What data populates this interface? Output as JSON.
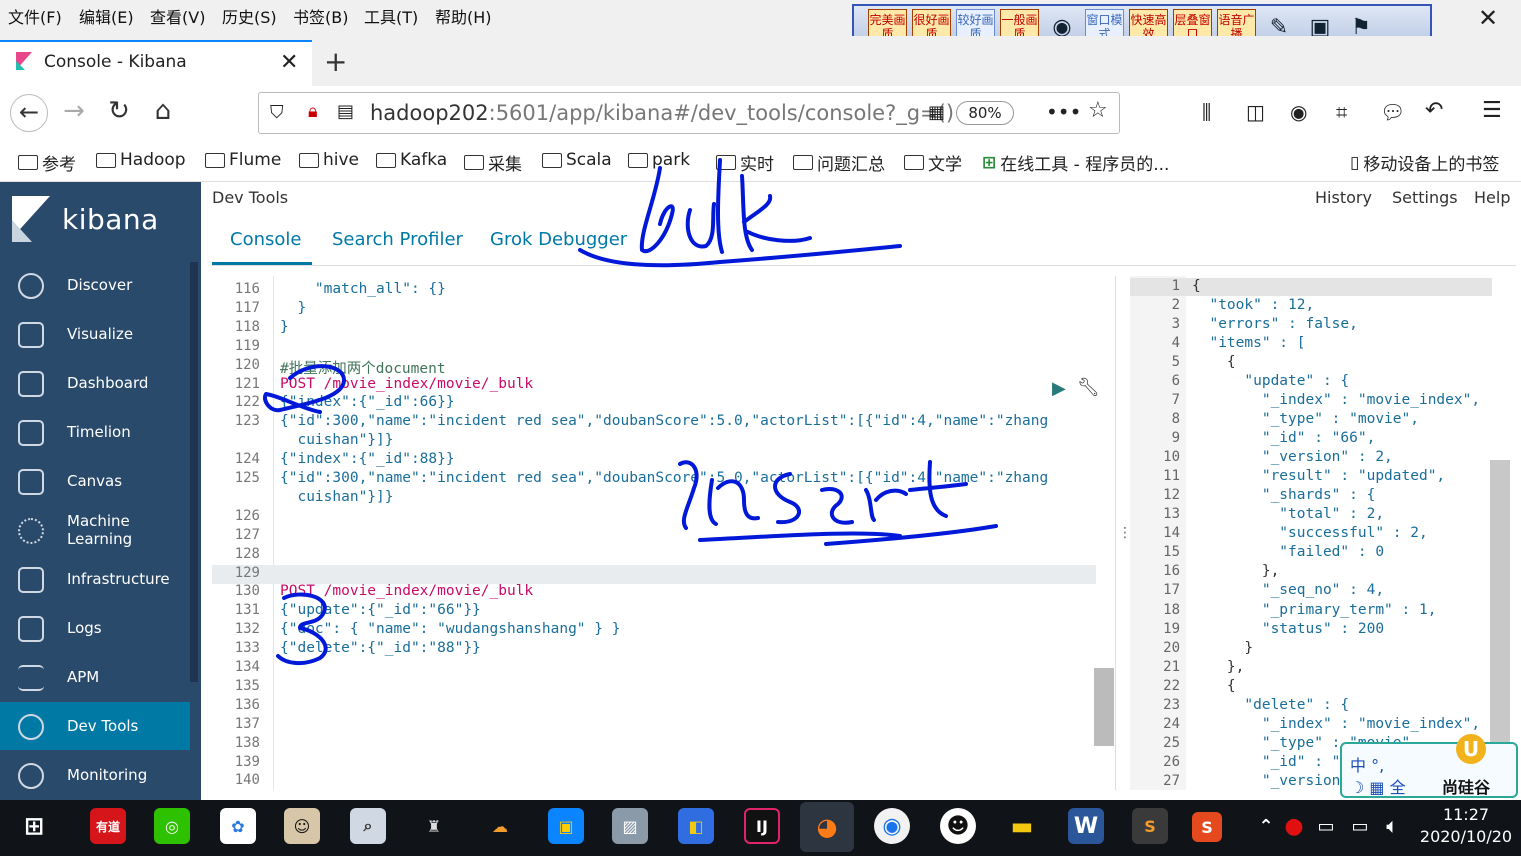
{
  "menubar": {
    "items": [
      "文件(F)",
      "编辑(E)",
      "查看(V)",
      "历史(S)",
      "书签(B)",
      "工具(T)",
      "帮助(H)"
    ]
  },
  "ext_toolbar": {
    "buttons": [
      "完美画质",
      "很好画质",
      "较好画质",
      "一般画质",
      "窗口模式",
      "快速高效",
      "层叠窗口",
      "语音广播"
    ]
  },
  "tab": {
    "title": "Console - Kibana"
  },
  "url": {
    "host": "hadoop202",
    "rest": ":5601/app/kibana#/dev_tools/console?_g=()",
    "zoom": "80%"
  },
  "bookmarks": [
    "参考",
    "Hadoop",
    "Flume",
    "hive",
    "Kafka",
    "采集",
    "Scala",
    "park",
    "实时",
    "问题汇总",
    "文学",
    "在线工具 - 程序员的...",
    "移动设备上的书签"
  ],
  "kibana": {
    "brand": "kibana",
    "nav": [
      "Discover",
      "Visualize",
      "Dashboard",
      "Timelion",
      "Canvas",
      "Machine Learning",
      "Infrastructure",
      "Logs",
      "APM",
      "Dev Tools",
      "Monitoring"
    ],
    "active": "Dev Tools"
  },
  "devtools": {
    "title": "Dev Tools",
    "links": [
      "History",
      "Settings",
      "Help"
    ],
    "tabs": [
      "Console",
      "Search Profiler",
      "Grok Debugger"
    ]
  },
  "editor": {
    "lines": [
      {
        "n": "116",
        "t": "    \"match_all\": {}"
      },
      {
        "n": "117",
        "t": "  }"
      },
      {
        "n": "118",
        "t": "}"
      },
      {
        "n": "119",
        "t": ""
      },
      {
        "n": "120",
        "t": "#批量添加两个document"
      },
      {
        "n": "121",
        "t": "POST /movie_index/movie/_bulk"
      },
      {
        "n": "122",
        "t": "{\"index\":{\"_id\":66}}"
      },
      {
        "n": "123",
        "t": "{\"id\":300,\"name\":\"incident red sea\",\"doubanScore\":5.0,\"actorList\":[{\"id\":4,\"name\":\"zhang"
      },
      {
        "n": "",
        "t": "  cuishan\"}]}"
      },
      {
        "n": "124",
        "t": "{\"index\":{\"_id\":88}}"
      },
      {
        "n": "125",
        "t": "{\"id\":300,\"name\":\"incident red sea\",\"doubanScore\":5.0,\"actorList\":[{\"id\":4,\"name\":\"zhang"
      },
      {
        "n": "",
        "t": "  cuishan\"}]}"
      },
      {
        "n": "126",
        "t": ""
      },
      {
        "n": "127",
        "t": ""
      },
      {
        "n": "128",
        "t": ""
      },
      {
        "n": "129",
        "t": ""
      },
      {
        "n": "130",
        "t": "POST /movie_index/movie/_bulk"
      },
      {
        "n": "131",
        "t": "{\"update\":{\"_id\":\"66\"}}"
      },
      {
        "n": "132",
        "t": "{\"doc\": { \"name\": \"wudangshanshang\" } }"
      },
      {
        "n": "133",
        "t": "{\"delete\":{\"_id\":\"88\"}}"
      },
      {
        "n": "134",
        "t": ""
      },
      {
        "n": "135",
        "t": ""
      },
      {
        "n": "136",
        "t": ""
      },
      {
        "n": "137",
        "t": ""
      },
      {
        "n": "138",
        "t": ""
      },
      {
        "n": "139",
        "t": ""
      },
      {
        "n": "140",
        "t": ""
      }
    ]
  },
  "output": {
    "lines": [
      {
        "n": "1",
        "t": "{"
      },
      {
        "n": "2",
        "t": "  \"took\" : 12,"
      },
      {
        "n": "3",
        "t": "  \"errors\" : false,"
      },
      {
        "n": "4",
        "t": "  \"items\" : ["
      },
      {
        "n": "5",
        "t": "    {"
      },
      {
        "n": "6",
        "t": "      \"update\" : {"
      },
      {
        "n": "7",
        "t": "        \"_index\" : \"movie_index\","
      },
      {
        "n": "8",
        "t": "        \"_type\" : \"movie\","
      },
      {
        "n": "9",
        "t": "        \"_id\" : \"66\","
      },
      {
        "n": "10",
        "t": "        \"_version\" : 2,"
      },
      {
        "n": "11",
        "t": "        \"result\" : \"updated\","
      },
      {
        "n": "12",
        "t": "        \"_shards\" : {"
      },
      {
        "n": "13",
        "t": "          \"total\" : 2,"
      },
      {
        "n": "14",
        "t": "          \"successful\" : 2,"
      },
      {
        "n": "15",
        "t": "          \"failed\" : 0"
      },
      {
        "n": "16",
        "t": "        },"
      },
      {
        "n": "17",
        "t": "        \"_seq_no\" : 4,"
      },
      {
        "n": "18",
        "t": "        \"_primary_term\" : 1,"
      },
      {
        "n": "19",
        "t": "        \"status\" : 200"
      },
      {
        "n": "20",
        "t": "      }"
      },
      {
        "n": "21",
        "t": "    },"
      },
      {
        "n": "22",
        "t": "    {"
      },
      {
        "n": "23",
        "t": "      \"delete\" : {"
      },
      {
        "n": "24",
        "t": "        \"_index\" : \"movie_index\","
      },
      {
        "n": "25",
        "t": "        \"_type\" : \"movie\","
      },
      {
        "n": "26",
        "t": "        \"_id\" : \""
      },
      {
        "n": "27",
        "t": "        \"_version"
      }
    ]
  },
  "ime": {
    "label": "中 °,",
    "brand": "尚硅谷"
  },
  "taskbar": {
    "time": "11:27",
    "date": "2020/10/20"
  },
  "colors": {
    "sidebar": "#2a4a6b",
    "accent": "#0079a5",
    "annotation": "#0018d8"
  }
}
